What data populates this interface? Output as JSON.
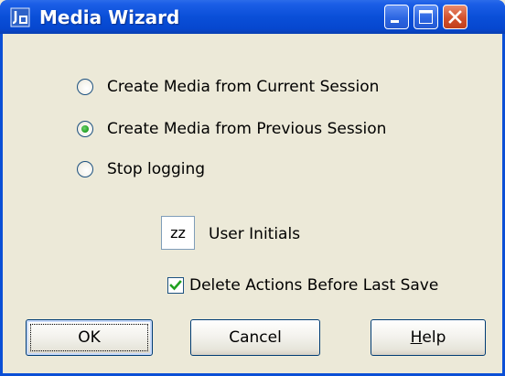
{
  "window": {
    "title": "Media Wizard",
    "icon": "media-wizard-app-icon",
    "controls": [
      "minimize-icon",
      "maximize-icon",
      "close-icon"
    ]
  },
  "options": [
    {
      "label": "Create Media from Current Session",
      "selected": false
    },
    {
      "label": "Create Media from Previous Session",
      "selected": true
    },
    {
      "label": "Stop logging",
      "selected": false
    }
  ],
  "initials": {
    "value": "zz",
    "label": "User Initials"
  },
  "delete_actions": {
    "label": "Delete Actions Before Last Save",
    "checked": true
  },
  "buttons": {
    "ok": "OK",
    "cancel": "Cancel",
    "help_prefix": "H",
    "help_rest": "elp"
  },
  "colors": {
    "titlebar": "#0a4fd8",
    "face": "#ece9d8",
    "selected_dot": "#29a629",
    "check": "#21a121"
  }
}
